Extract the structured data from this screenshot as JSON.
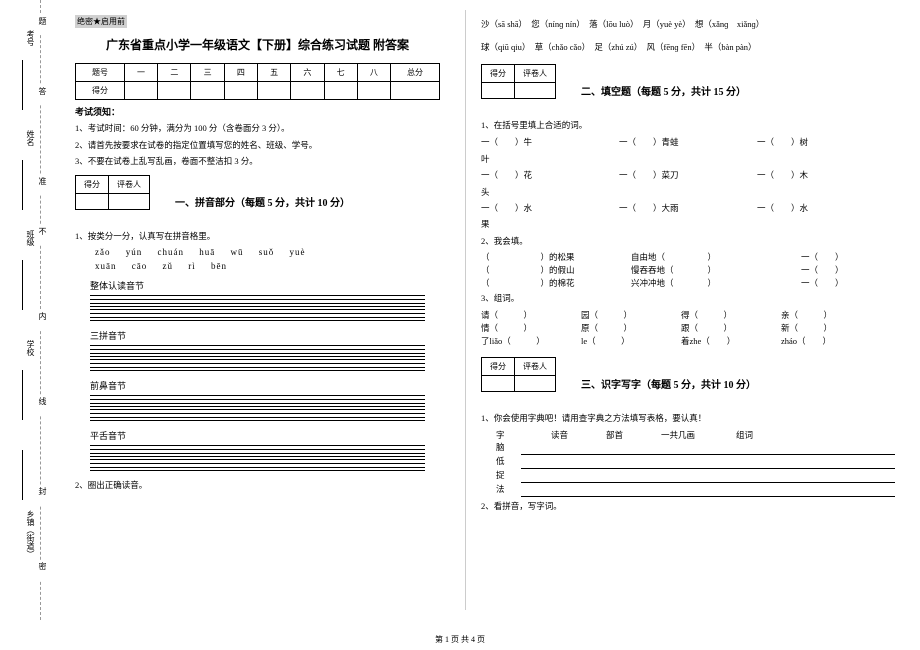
{
  "confidential": "绝密★启用前",
  "title": "广东省重点小学一年级语文【下册】综合练习试题 附答案",
  "score_headers": [
    "题号",
    "一",
    "二",
    "三",
    "四",
    "五",
    "六",
    "七",
    "八",
    "总分"
  ],
  "score_row_label": "得分",
  "exam_notice_title": "考试须知：",
  "exam_notices": [
    "1、考试时间：60 分钟，满分为 100 分（含卷面分 3 分）。",
    "2、请首先按要求在试卷的指定位置填写您的姓名、班级、学号。",
    "3、不要在试卷上乱写乱画，卷面不整洁扣 3 分。"
  ],
  "small_box": {
    "score": "得分",
    "reviewer": "评卷人"
  },
  "section1_title": "一、拼音部分（每题 5 分，共计 10 分）",
  "q1_1": "1、按类分一分，认真写在拼音格里。",
  "pinyin_rows": [
    "zǎo  yún  chuán  huā  wū  suǒ  yuè",
    "xuān  cāo  zǔ  rì  bēn"
  ],
  "categories": [
    "整体认读音节",
    "三拼音节",
    "前鼻音节",
    "平舌音节"
  ],
  "q1_2": "2、圈出正确读音。",
  "ruyin_items": [
    "沙（sā shā）　您（nínɡ nín）　落（lōu luò）　月（yuè yè）　想（xǎnɡ　xiǎnɡ）",
    "球（qiū qiu）　草（chǎo cǎo）　足（zhú zú）　风（fēnɡ fēn）　半（bàn  pàn）"
  ],
  "section2_title": "二、填空题（每题 5 分，共计 15 分）",
  "q2_1": "1、在括号里填上合适的词。",
  "q2_1_rows": [
    [
      "一（　　）牛",
      "一（　　）青蛙",
      "一（　　）树"
    ],
    [
      "叶",
      "",
      ""
    ],
    [
      "一（　　）花",
      "一（　　）菜刀",
      "一（　　）木"
    ],
    [
      "头",
      "",
      ""
    ],
    [
      "一（　　）水",
      "一（　　）大雨",
      "一（　　）水"
    ],
    [
      "果",
      "",
      ""
    ]
  ],
  "q2_2": "2、我会填。",
  "q2_2_rows": [
    [
      "（　　　　　　）的松果",
      "自由地（　　　　　）",
      "一（　　）"
    ],
    [
      "（　　　　　　）的假山",
      "慢吞吞地（　　　　）",
      "一（　　）"
    ],
    [
      "（　　　　　　）的棉花",
      "兴冲冲地（　　　　）",
      "一（　　）"
    ]
  ],
  "q2_3": "3、组词。",
  "q2_3_rows": [
    [
      "请（　　　）",
      "园（　　　）",
      "得（　　　）",
      "亲（　　　）"
    ],
    [
      "情（　　　）",
      "原（　　　）",
      "跟（　　　）",
      "新（　　　）"
    ],
    [
      "了liǎo（　　　）",
      "le（　　　）",
      "着zhe（　　）",
      "zháo（　　）"
    ]
  ],
  "section3_title": "三、识字写字（每题 5 分，共计 10 分）",
  "q3_1": "1、你会使用字典吧！请用查字典之方法填写表格，要认真！",
  "dict_headers": [
    "字",
    "读音",
    "部首",
    "一共几画",
    "组词"
  ],
  "dict_chars": [
    "脑",
    "低",
    "捉",
    "法"
  ],
  "q3_2": "2、看拼音，写字词。",
  "footer": "第 1 页 共 4 页",
  "margin_labels": {
    "l1": "考号",
    "l2": "姓名",
    "l3": "班级",
    "l4": "学校",
    "l5": "乡镇（街道）"
  },
  "dash_labels": [
    "题",
    "答",
    "准",
    "不",
    "内",
    "线",
    "封",
    "密"
  ]
}
